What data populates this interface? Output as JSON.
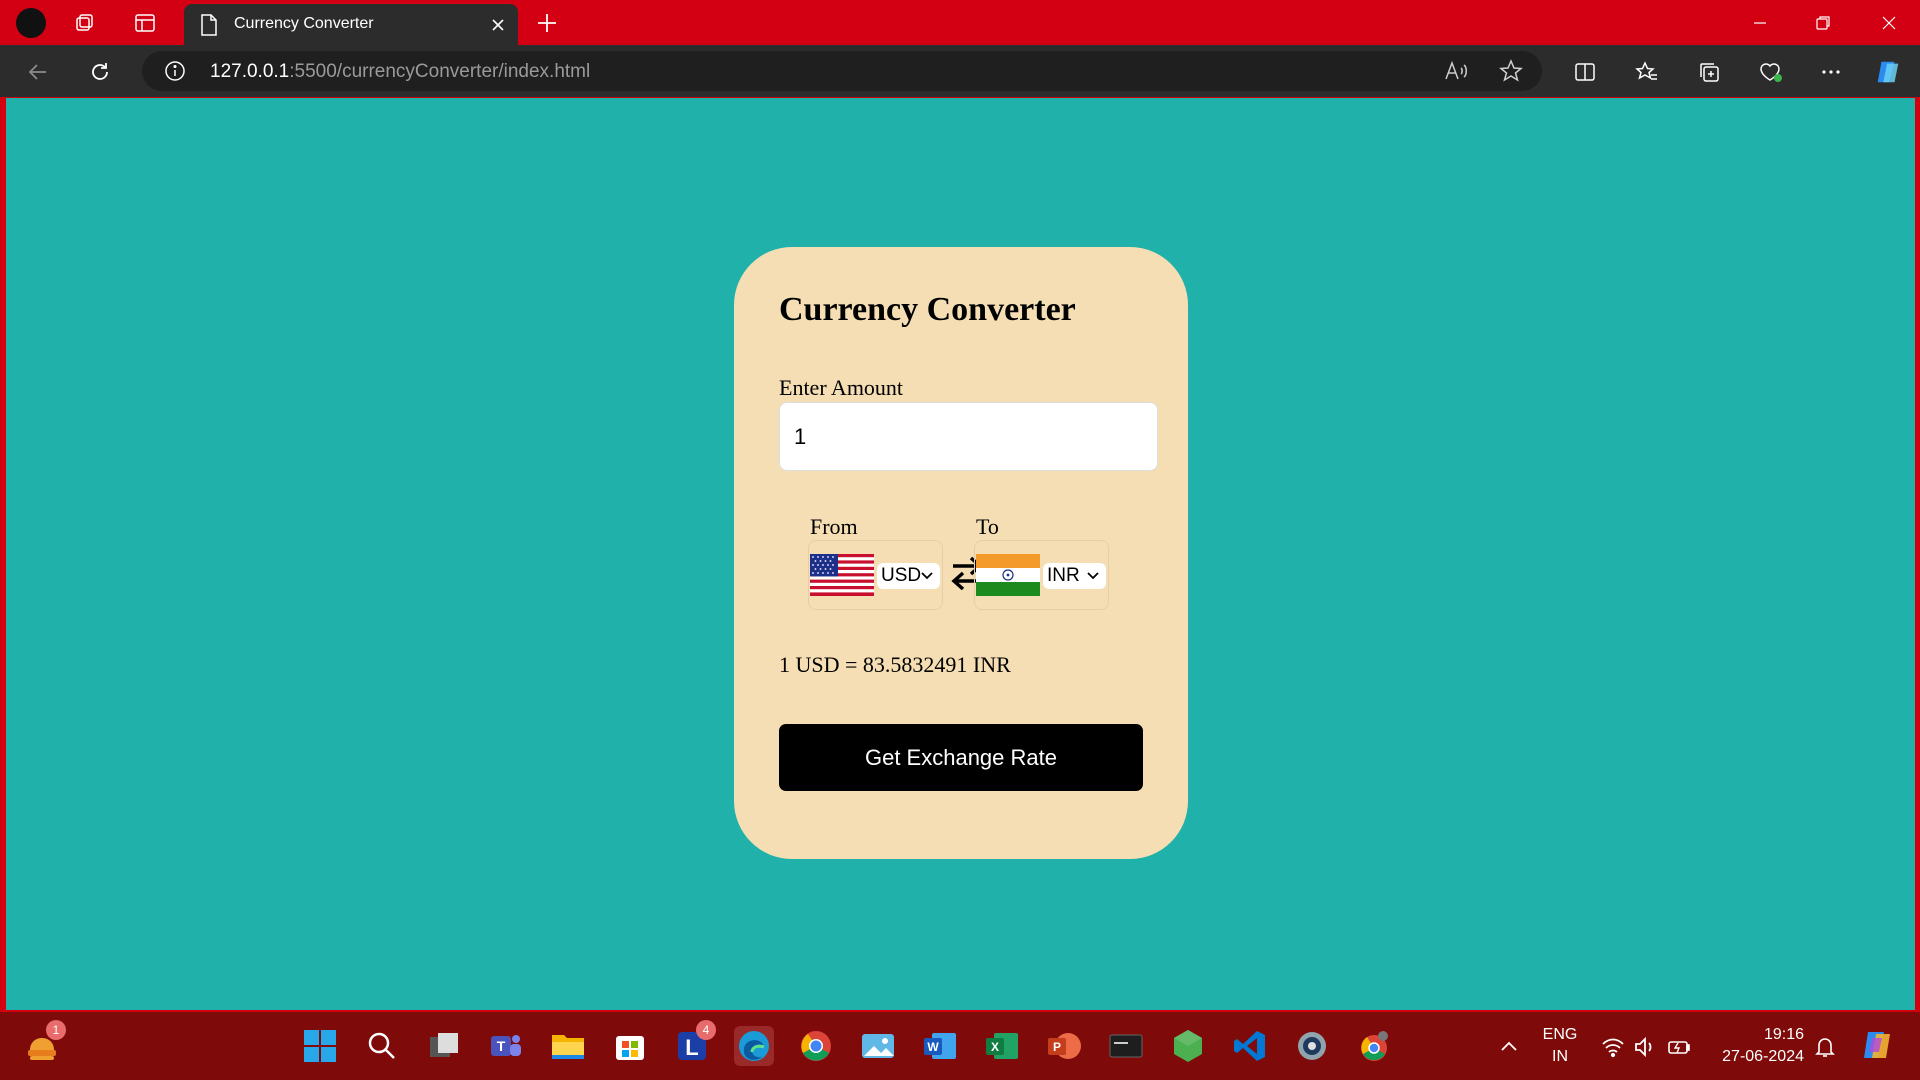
{
  "browser": {
    "tab_title": "Currency Converter",
    "url_host": "127.0.0.1",
    "url_rest": ":5500/currencyConverter/index.html"
  },
  "page": {
    "title": "Currency Converter",
    "amount_label": "Enter Amount",
    "amount_value": "1",
    "from_label": "From",
    "to_label": "To",
    "from_currency": "USD",
    "to_currency": "INR",
    "result_text": "1 USD = 83.5832491 INR",
    "button_label": "Get Exchange Rate",
    "colors": {
      "background": "#20b1ab",
      "card": "#f5deb3",
      "button": "#000000"
    }
  },
  "taskbar": {
    "weather_badge": "1",
    "lens_badge": "4",
    "lang_top": "ENG",
    "lang_bottom": "IN",
    "time": "19:16",
    "date": "27-06-2024",
    "apps": [
      "windows-start",
      "search",
      "task-view",
      "teams",
      "file-explorer",
      "store",
      "lens",
      "edge",
      "chrome",
      "photos",
      "word",
      "excel",
      "powerpoint",
      "mysql",
      "node",
      "vscode",
      "app",
      "chrome-dev"
    ]
  }
}
